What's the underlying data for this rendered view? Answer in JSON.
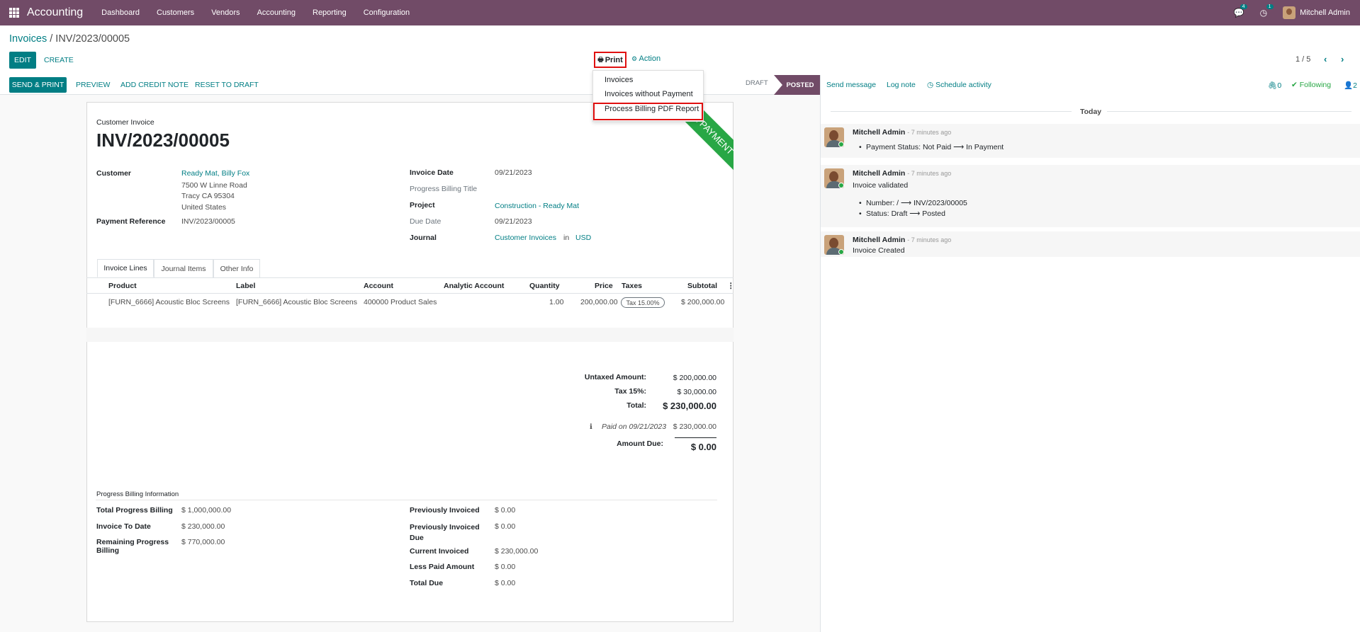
{
  "navbar": {
    "app_name": "Accounting",
    "menu": [
      "Dashboard",
      "Customers",
      "Vendors",
      "Accounting",
      "Reporting",
      "Configuration"
    ],
    "messages_badge": "4",
    "activities_badge": "1",
    "user_name": "Mitchell Admin"
  },
  "breadcrumb": {
    "parent": "Invoices",
    "separator": " / ",
    "current": "INV/2023/00005"
  },
  "toolbar": {
    "edit": "EDIT",
    "create": "CREATE",
    "print": "Print",
    "action": "Action",
    "pager": "1 / 5",
    "prev_icon": "chevron-left-icon",
    "next_icon": "chevron-right-icon"
  },
  "print_menu": {
    "items": [
      "Invoices",
      "Invoices without Payment",
      "Process Billing PDF Report"
    ]
  },
  "header_buttons": {
    "send_print": "SEND & PRINT",
    "preview": "PREVIEW",
    "add_credit_note": "ADD CREDIT NOTE",
    "reset_to_draft": "RESET TO DRAFT"
  },
  "status": {
    "draft": "DRAFT",
    "posted": "POSTED"
  },
  "invoice": {
    "type": "Customer Invoice",
    "number": "INV/2023/00005",
    "ribbon": "IN PAYMENT",
    "customer_label": "Customer",
    "customer_name": "Ready Mat, Billy Fox",
    "address": [
      "7500 W Linne Road",
      "Tracy CA 95304",
      "United States"
    ],
    "payment_reference_label": "Payment Reference",
    "payment_reference": "INV/2023/00005",
    "invoice_date_label": "Invoice Date",
    "invoice_date": "09/21/2023",
    "progress_billing_title_label": "Progress Billing Title",
    "project_label": "Project",
    "project": "Construction - Ready Mat",
    "due_date_label": "Due Date",
    "due_date": "09/21/2023",
    "journal_label": "Journal",
    "journal": "Customer Invoices",
    "journal_in": "in",
    "currency": "USD"
  },
  "tabs": [
    "Invoice Lines",
    "Journal Items",
    "Other Info"
  ],
  "lines": {
    "columns": [
      "Product",
      "Label",
      "Account",
      "Analytic Account",
      "Quantity",
      "Price",
      "Taxes",
      "Subtotal"
    ],
    "rows": [
      {
        "product": "[FURN_6666] Acoustic Bloc Screens",
        "label": "[FURN_6666] Acoustic Bloc Screens",
        "account": "400000 Product Sales",
        "analytic": "",
        "quantity": "1.00",
        "price": "200,000.00",
        "taxes": "Tax 15.00%",
        "subtotal": "$ 200,000.00"
      }
    ]
  },
  "totals": {
    "untaxed_label": "Untaxed Amount:",
    "untaxed": "$ 200,000.00",
    "tax_label": "Tax 15%:",
    "tax": "$ 30,000.00",
    "total_label": "Total:",
    "total": "$ 230,000.00",
    "paid_label": "Paid on 09/21/2023",
    "paid": "$ 230,000.00",
    "amount_due_label": "Amount Due:",
    "amount_due": "$ 0.00"
  },
  "progress_billing": {
    "section_title": "Progress Billing Information",
    "total_progress_billing_label": "Total Progress Billing",
    "total_progress_billing": "$ 1,000,000.00",
    "invoice_to_date_label": "Invoice To Date",
    "invoice_to_date": "$ 230,000.00",
    "remaining_label_1": "Remaining Progress",
    "remaining_label_2": "Billing",
    "remaining": "$ 770,000.00",
    "previously_invoiced_label": "Previously Invoiced",
    "previously_invoiced": "$ 0.00",
    "previously_invoiced_due_label_1": "Previously Invoiced",
    "previously_invoiced_due_label_2": "Due",
    "previously_invoiced_due": "$ 0.00",
    "current_invoiced_label": "Current Invoiced",
    "current_invoiced": "$ 230,000.00",
    "less_paid_label": "Less Paid Amount",
    "less_paid": "$ 0.00",
    "total_due_label": "Total Due",
    "total_due": "$ 0.00"
  },
  "chatter": {
    "send_message": "Send message",
    "log_note": "Log note",
    "schedule_activity": "Schedule activity",
    "attachments_count": "0",
    "following": "Following",
    "followers_count": "2",
    "today": "Today",
    "messages": [
      {
        "author": "Mitchell Admin",
        "time": "- 7 minutes ago",
        "body": "",
        "bullets": [
          "Payment Status: Not Paid ⟶ In Payment"
        ]
      },
      {
        "author": "Mitchell Admin",
        "time": "- 7 minutes ago",
        "body": "Invoice validated",
        "bullets": [
          "Number: / ⟶ INV/2023/00005",
          "Status: Draft ⟶ Posted"
        ]
      },
      {
        "author": "Mitchell Admin",
        "time": "- 7 minutes ago",
        "body": "Invoice Created",
        "bullets": []
      }
    ]
  },
  "colors": {
    "brand": "#714b67",
    "accent": "#017e84",
    "ribbon": "#28a745",
    "highlight_border": "#e01010"
  }
}
